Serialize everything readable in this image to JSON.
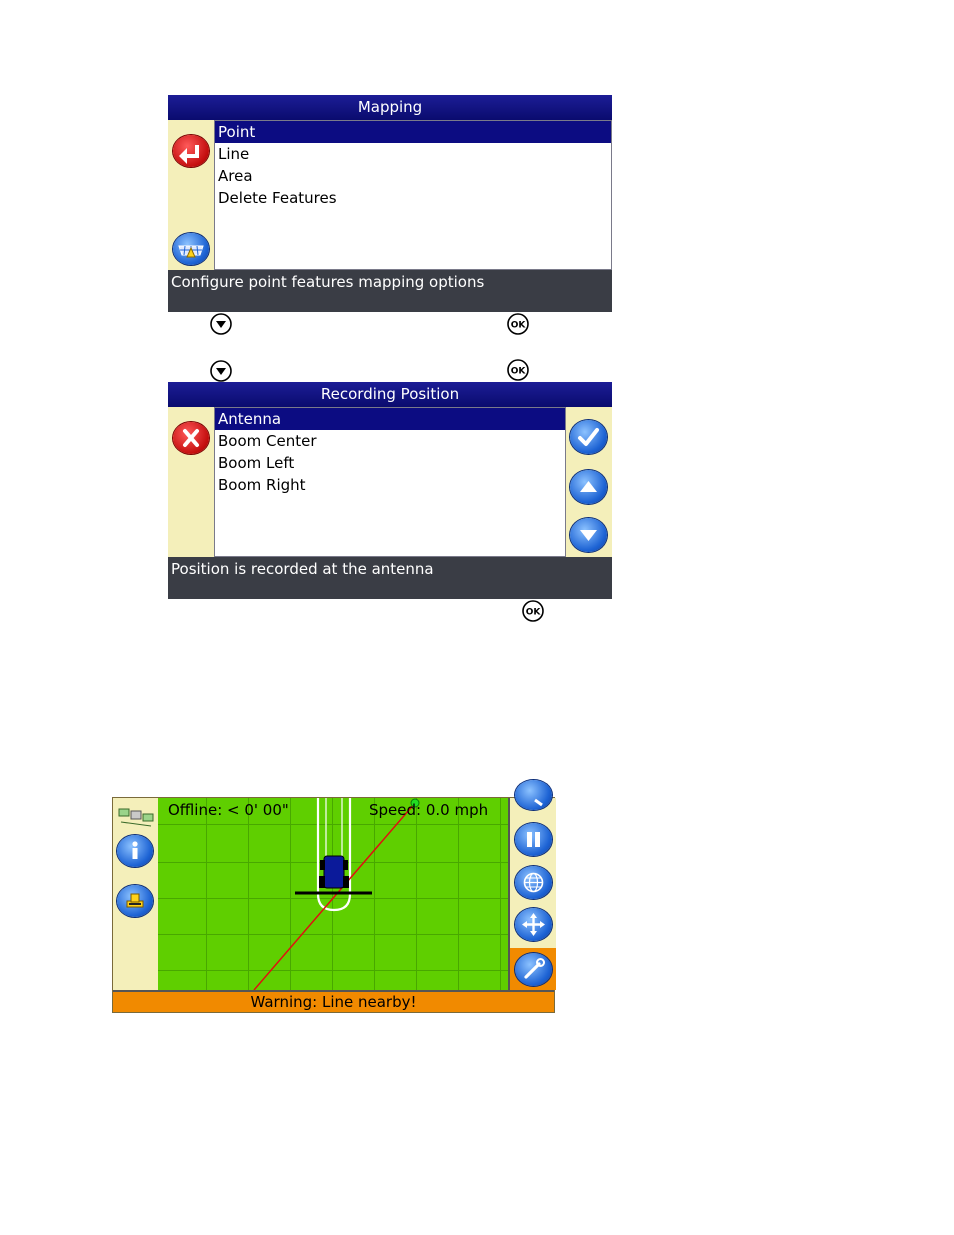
{
  "mapping": {
    "title": "Mapping",
    "items": [
      "Point",
      "Line",
      "Area",
      "Delete Features"
    ],
    "selected": 0,
    "status": "Configure point features mapping options",
    "icons": {
      "back": "back-arrow-icon",
      "mapping": "mapping-icon"
    }
  },
  "recording": {
    "title": "Recording Position",
    "items": [
      "Antenna",
      "Boom Center",
      "Boom Left",
      "Boom Right"
    ],
    "selected": 0,
    "status": "Position is recorded at the antenna",
    "icons": {
      "cancel": "cancel-x-icon",
      "accept": "checkmark-icon",
      "up": "arrow-up-icon",
      "down": "arrow-down-icon"
    }
  },
  "keys": {
    "down_icon": "down-arrow-key-icon",
    "ok_icon": "ok-key-icon",
    "ok_label": "OK"
  },
  "guidance": {
    "offline": "Offline:  < 0' 00\"",
    "speed": "Speed:  0.0 mph",
    "warning": "Warning: Line nearby!",
    "colors": {
      "field": "#5fcf00",
      "warning": "#f18a00",
      "panel": "#f4efba"
    },
    "left_icons": [
      "satellite-icon",
      "info-icon",
      "vehicle-icon"
    ],
    "right_icons": [
      "zoom-icon",
      "pause-icon",
      "globe-icon",
      "pan-icon",
      "wrench-icon"
    ]
  }
}
